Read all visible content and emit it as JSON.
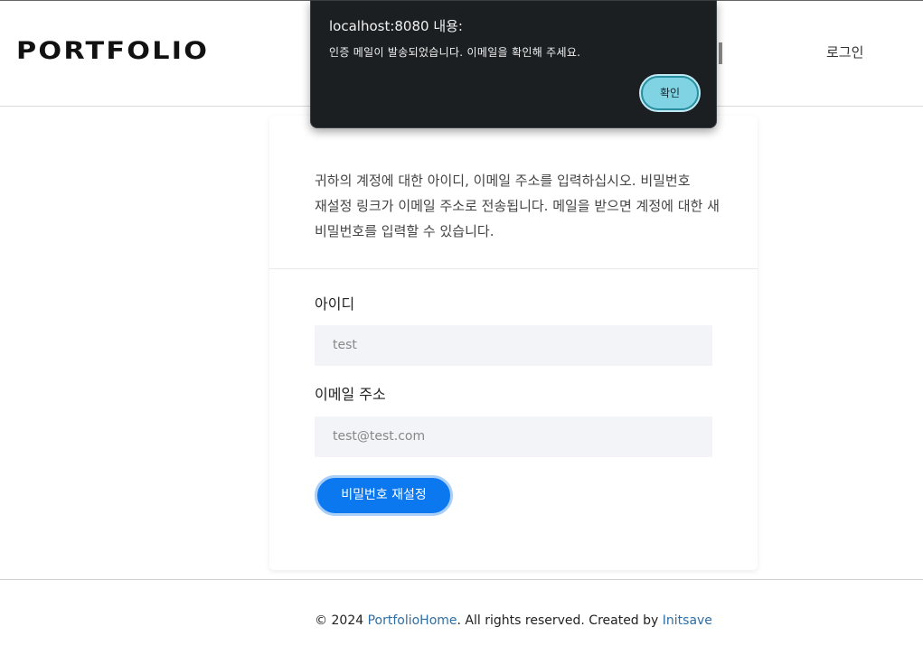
{
  "navbar": {
    "brand": "PORTFOLIO",
    "login_label": "로그인"
  },
  "reset_form": {
    "intro": "귀하의 계정에 대한 아이디, 이메일 주소를 입력하십시오. 비밀번호 재설정 링크가 이메일 주소로 전송됩니다. 메일을 받으면 계정에 대한 새 비밀번호를 입력할 수 있습니다.",
    "id_label": "아이디",
    "id_value": "test",
    "email_label": "이메일 주소",
    "email_value": "test@test.com",
    "submit_label": "비밀번호 재설정"
  },
  "footer": {
    "prefix": "© 2024 ",
    "site_link": "PortfolioHome",
    "middle": ". All rights reserved. Created by ",
    "author_link": "Initsave"
  },
  "alert": {
    "title": "localhost:8080 내용:",
    "message": "인증 메일이 발송되었습니다. 이메일을 확인해 주세요.",
    "ok_label": "확인"
  },
  "colors": {
    "primary_button": "#0b78f0",
    "link": "#2f6ea2",
    "dialog_bg": "#1b1f22",
    "dialog_button": "#7fd3e3"
  }
}
